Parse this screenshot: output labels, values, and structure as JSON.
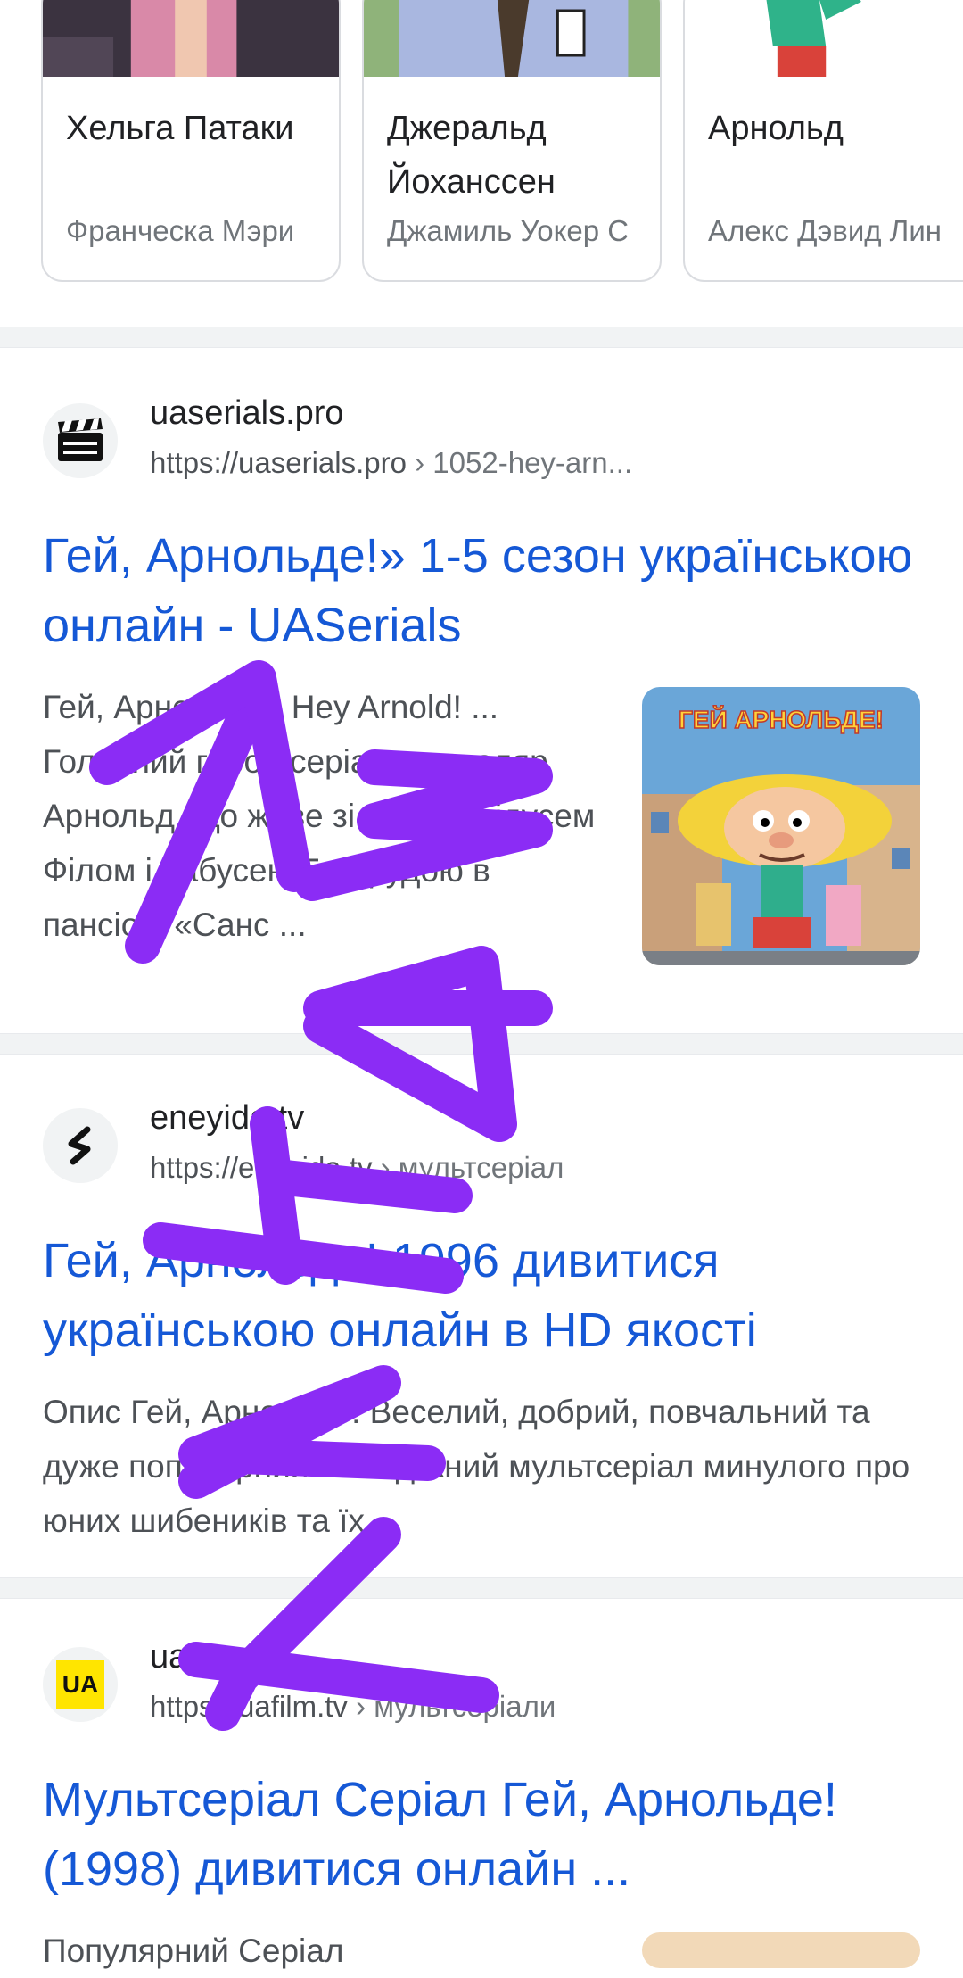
{
  "cast": [
    {
      "name": "Хельга Патаки",
      "actor": "Франческа Мэри"
    },
    {
      "name": "Джеральд Йохансcен",
      "actor": "Джамиль Уокер С"
    },
    {
      "name": "Арнольд",
      "actor": "Алекс Дэвид Лин"
    }
  ],
  "results": [
    {
      "site_name": "uaserials.pro",
      "url_base": "https://uaserials.pro",
      "url_path": " › 1052-hey-arn...",
      "title": "Гей, Арнольде!» 1-5 сезон українською онлайн - UASerials",
      "snippet": "Гей, Арнольде!. Hey Arnold! ... Головний герой серіалу - школяр Арнольд, що живе зі своїми дідусем Філом і бабусею Гертрудою в пансіоні «Санс ...",
      "favicon": "clapperboard-icon",
      "thumb_text": "ГЕЙ АРНОЛЬДЕ!"
    },
    {
      "site_name": "eneyida.tv",
      "url_base": "https://eneyida.tv",
      "url_path": " › мультсеріал",
      "title": "Гей, Арнольде! 1996 дивитися українською онлайн в HD якості",
      "snippet": "Опис Гей, Арнольде! Веселий, добрий, повчальний та дуже популярний молодіжний мультсеріал минулого про юних шибеників та їх...",
      "favicon": "eneyida-logo-icon"
    },
    {
      "site_name": "uafilm.tv",
      "url_base": "https://uafilm.tv",
      "url_path": " › мультсеріали",
      "title": "Мультсеріал Серіал Гей, Арнольде! (1998) дивитися онлайн ...",
      "snippet": "Популярний Серіал",
      "favicon": "UA"
    }
  ],
  "colors": {
    "link": "#1558d6",
    "scribble": "#8b2cf5",
    "divider": "#f1f3f4"
  }
}
